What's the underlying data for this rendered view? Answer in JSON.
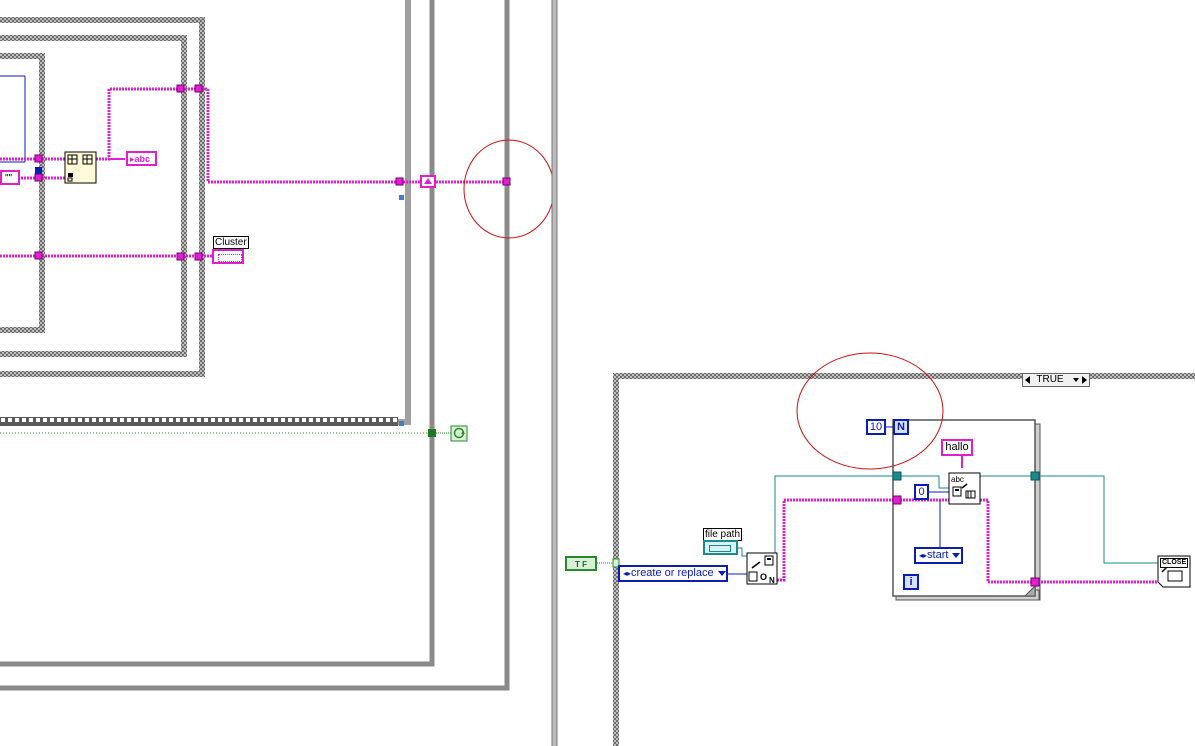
{
  "case_selector": {
    "label": "TRUE"
  },
  "indicators": {
    "cluster_label": "Cluster",
    "string_indicator_glyph": "▸abc"
  },
  "constants": {
    "empty_string": "\"\"",
    "loop_count": "10",
    "loop_count_terminal": "N",
    "hallo": "hallo",
    "zero": "0",
    "start_mode": "start",
    "iteration_terminal": "i",
    "boolean_true": "T F",
    "file_operation": "create or replace"
  },
  "controls": {
    "file_path_label": "file path"
  },
  "functions": {
    "close_label": "CLOSE",
    "write_abc": "abc"
  },
  "colors": {
    "string_wire": "#e020d0",
    "refnum_wire": "#1a8a8a",
    "numeric_wire": "#0a1eb4",
    "boolean_wire": "#2a8a2a",
    "structure_border": "#888888",
    "annotation": "#cc1111"
  }
}
